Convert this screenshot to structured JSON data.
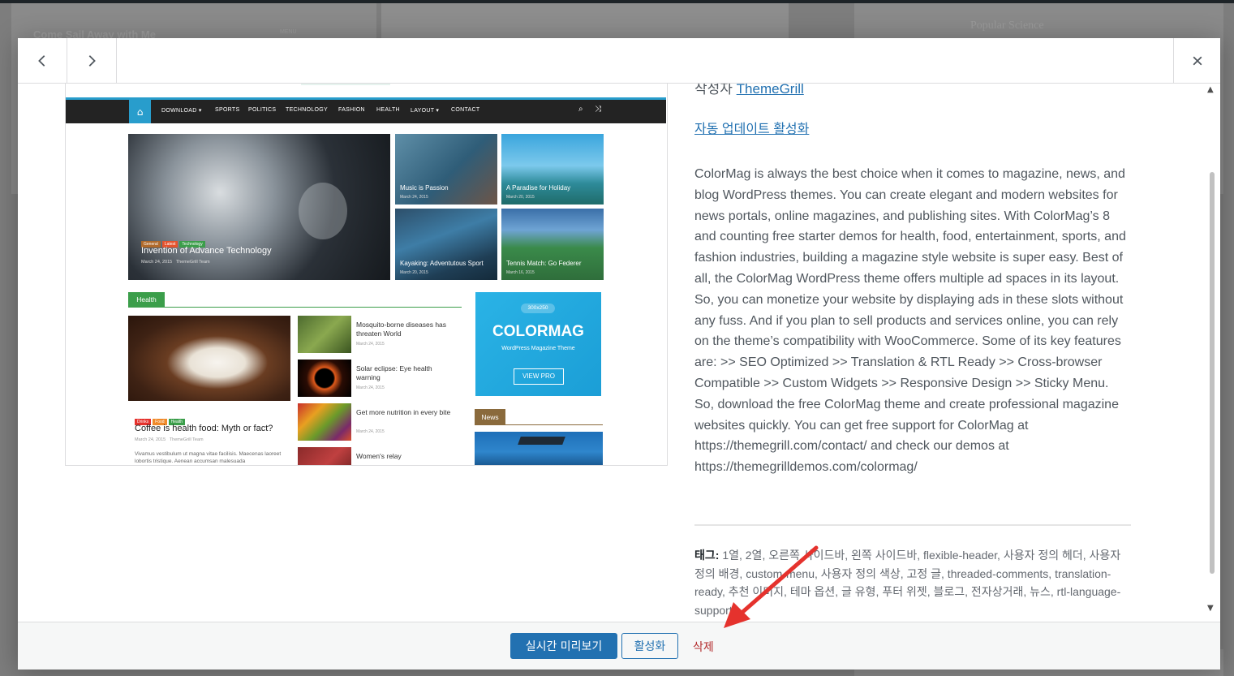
{
  "background": {
    "left_card_title": "Come Sail Away with Me",
    "left_card_tag": "MENU",
    "right_card_title": "Popular Science"
  },
  "header": {
    "prev_icon": "chevron-left-icon",
    "next_icon": "chevron-right-icon",
    "close_icon": "close-icon"
  },
  "screenshot": {
    "nav_items": [
      "DOWNLOAD ▾",
      "SPORTS",
      "POLITICS",
      "TECHNOLOGY",
      "FASHION",
      "HEALTH",
      "LAYOUT ▾",
      "CONTACT"
    ],
    "featured": {
      "cats": [
        "General",
        "Latest",
        "Technology"
      ],
      "title": "Invention of Advance Technology",
      "date": "March 24, 2015",
      "author": "ThemeGrill Team"
    },
    "tiles": [
      {
        "title": "Music is Passion",
        "date": "March 24, 2015"
      },
      {
        "title": "A Paradise for Holiday",
        "date": "March 20, 2015"
      },
      {
        "title": "Kayaking: Adventutous Sport",
        "date": "March 20, 2015"
      },
      {
        "title": "Tennis Match: Go Federer",
        "date": "March 16, 2015"
      }
    ],
    "health_label": "Health",
    "health_main": {
      "cats": [
        "Drinks",
        "Food",
        "Health"
      ],
      "title": "Coffee is health food: Myth or fact?",
      "date": "March 24, 2015",
      "author": "ThemeGrill Team",
      "excerpt": "Vivamus vestibulum ut magna vitae facilisis. Maecenas laoreet lobortis tristique. Aenean accumsan malesuada"
    },
    "health_items": [
      {
        "title": "Mosquito-borne diseases has threaten World",
        "date": "March 24, 2015"
      },
      {
        "title": "Solar eclipse: Eye health warning",
        "date": "March 24, 2015"
      },
      {
        "title": "Get more nutrition in every bite",
        "date": "March 24, 2015"
      },
      {
        "title": "Women's relay",
        "date": ""
      }
    ],
    "ad": {
      "size": "300x250",
      "brand": "COLORMAG",
      "tagline": "WordPress Magazine Theme",
      "cta": "VIEW PRO"
    },
    "news_label": "News"
  },
  "info": {
    "author_prefix": "작성자",
    "author_name": "ThemeGrill",
    "auto_update": "자동 업데이트 활성화",
    "description": "ColorMag is always the best choice when it comes to magazine, news, and blog WordPress themes. You can create elegant and modern websites for news portals, online magazines, and publishing sites. With ColorMag’s 8 and counting free starter demos for health, food, entertainment, sports, and fashion industries, building a magazine style website is super easy. Best of all, the ColorMag WordPress theme offers multiple ad spaces in its layout. So, you can monetize your website by displaying ads in these slots without any fuss. And if you plan to sell products and services online, you can rely on the theme’s compatibility with WooCommerce. Some of its key features are: >> SEO Optimized >> Translation & RTL Ready >> Cross-browser Compatible >> Custom Widgets >> Responsive Design >> Sticky Menu. So, download the free ColorMag theme and create professional magazine websites quickly. You can get free support for ColorMag at https://themegrill.com/contact/ and check our demos at https://themegrilldemos.com/colormag/",
    "tags_label": "태그:",
    "tags": "1열, 2열, 오른쪽 사이드바, 왼쪽 사이드바, flexible-header, 사용자 정의 헤더, 사용자 정의 배경, custom-menu, 사용자 정의 색상, 고정 글, threaded-comments, translation-ready, 추천 이미지, 테마 옵션, 글 유형, 푸터 위젯, 블로그, 전자상거래, 뉴스, rtl-language-support"
  },
  "footer": {
    "live_preview": "실시간 미리보기",
    "activate": "활성화",
    "delete": "삭제"
  },
  "colors": {
    "accent": "#2271b1",
    "delete": "#b32d2e",
    "annotation_arrow": "#e5322d"
  }
}
